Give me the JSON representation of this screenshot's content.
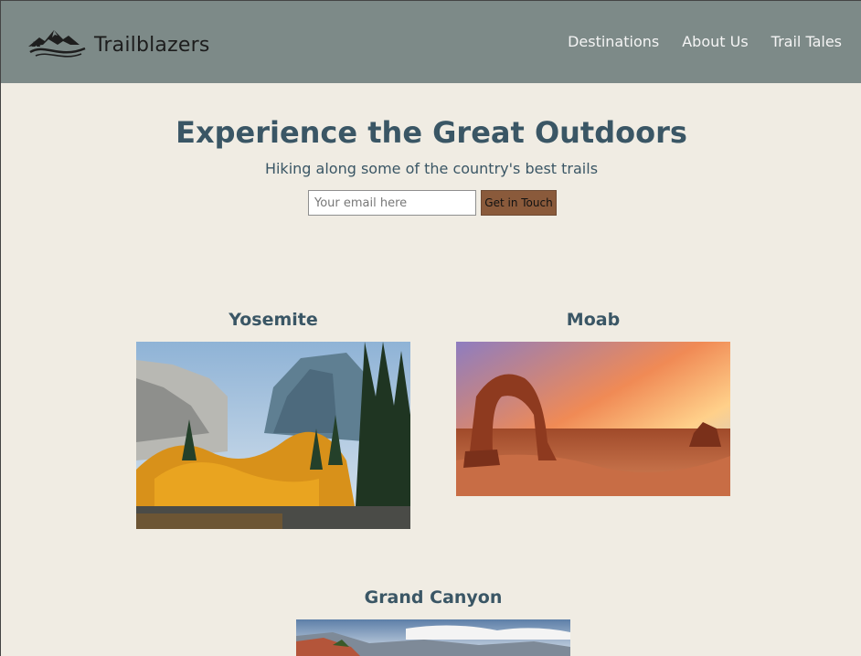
{
  "header": {
    "brand": "Trailblazers",
    "nav": [
      "Destinations",
      "About Us",
      "Trail Tales"
    ]
  },
  "hero": {
    "title": "Experience the Great Outdoors",
    "subtitle": "Hiking along some of the country's best trails",
    "email_placeholder": "Your email here",
    "cta_label": "Get in Touch"
  },
  "destinations": [
    {
      "name": "Yosemite"
    },
    {
      "name": "Moab"
    },
    {
      "name": "Grand Canyon"
    }
  ],
  "colors": {
    "header_bg": "#7d8a88",
    "page_bg": "#f0ece3",
    "heading": "#3a5665",
    "cta_bg": "#8a5a3b"
  }
}
